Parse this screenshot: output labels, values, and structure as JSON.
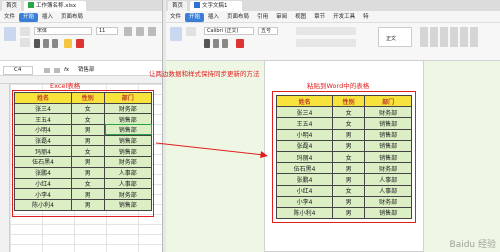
{
  "excel_window": {
    "tab_home": "首页",
    "tab_file": "工作簿名称.xlsx",
    "menu": [
      "文件",
      "开始",
      "插入",
      "页面布局"
    ],
    "font_name": "宋体",
    "font_size": "11",
    "cell_ref": "C4",
    "fx_icon": "fx-icon",
    "formula_value": "销售部"
  },
  "word_window": {
    "tab_home": "首页",
    "tab_file": "文字文稿1",
    "menu": [
      "文件",
      "开始",
      "插入",
      "页面布局",
      "引用",
      "审阅",
      "视图",
      "章节",
      "开发工具",
      "特"
    ],
    "font_name": "Calibri (正文)",
    "font_size": "五号",
    "style_label": "正文"
  },
  "annotations": {
    "excel_label": "Excel表格",
    "sync_label": "让两边数据和样式保持同步更新的方法",
    "word_label": "粘贴到Word中的表格"
  },
  "table": {
    "headers": [
      "姓名",
      "性别",
      "部门"
    ],
    "rows": [
      [
        "张三4",
        "女",
        "财务部"
      ],
      [
        "王五4",
        "女",
        "销售部"
      ],
      [
        "小明4",
        "男",
        "销售部"
      ],
      [
        "张磊4",
        "男",
        "销售部"
      ],
      [
        "玛丽4",
        "女",
        "销售部"
      ],
      [
        "伍石黑4",
        "男",
        "财务部"
      ],
      [
        "张鹏4",
        "男",
        "人事部"
      ],
      [
        "小红4",
        "女",
        "人事部"
      ],
      [
        "小李4",
        "男",
        "财务部"
      ],
      [
        "陈小利4",
        "男",
        "销售部"
      ]
    ]
  },
  "watermark": "Baidu 经验",
  "colors": {
    "header_bg": "#f7e33c",
    "cell_bg": "#dcefc4",
    "accent": "#e02020",
    "ribbon_blue": "#3a7fd5"
  }
}
